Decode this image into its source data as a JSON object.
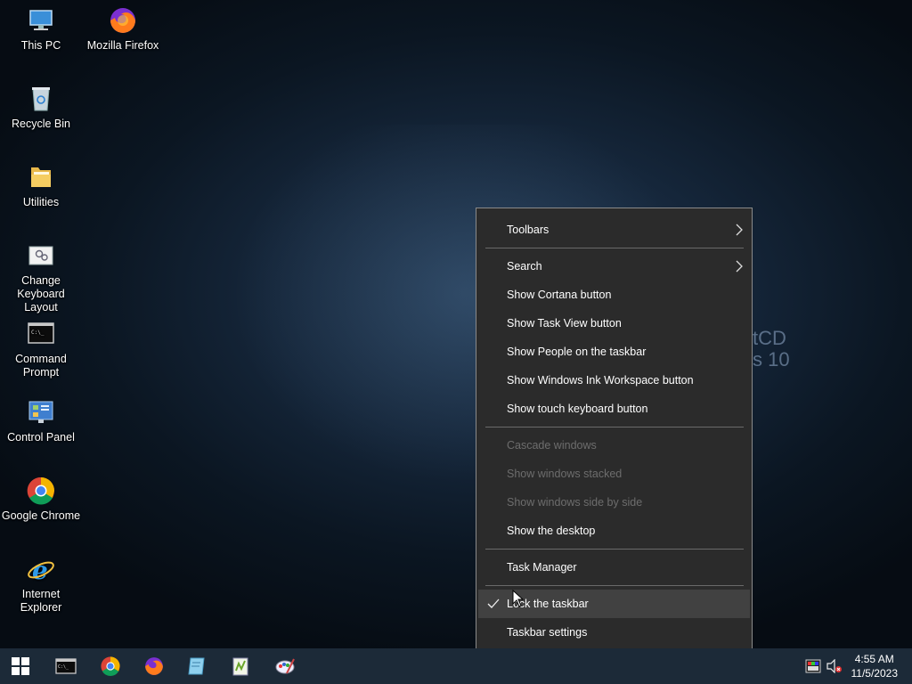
{
  "desktop": {
    "watermark_lines": [
      "tCD",
      "s 10"
    ],
    "icons": [
      {
        "label": "This PC",
        "icon": "this-pc-icon"
      },
      {
        "label": "Mozilla Firefox",
        "icon": "firefox-icon"
      },
      {
        "label": "Recycle Bin",
        "icon": "recycle-bin-icon"
      },
      {
        "label": "Utilities",
        "icon": "folder-icon"
      },
      {
        "label": "Change Keyboard Layout",
        "icon": "keyboard-layout-icon"
      },
      {
        "label": "Command Prompt",
        "icon": "command-prompt-icon"
      },
      {
        "label": "Control Panel",
        "icon": "control-panel-icon"
      },
      {
        "label": "Google Chrome",
        "icon": "chrome-icon"
      },
      {
        "label": "Internet Explorer",
        "icon": "internet-explorer-icon"
      }
    ]
  },
  "context_menu": {
    "items": [
      {
        "label": "Toolbars",
        "submenu": true
      },
      {
        "label": "Search",
        "submenu": true
      },
      {
        "label": "Show Cortana button"
      },
      {
        "label": "Show Task View button"
      },
      {
        "label": "Show People on the taskbar"
      },
      {
        "label": "Show Windows Ink Workspace button"
      },
      {
        "label": "Show touch keyboard button"
      },
      {
        "label": "Cascade windows",
        "disabled": true
      },
      {
        "label": "Show windows stacked",
        "disabled": true
      },
      {
        "label": "Show windows side by side",
        "disabled": true
      },
      {
        "label": "Show the desktop"
      },
      {
        "label": "Task Manager"
      },
      {
        "label": "Lock the taskbar",
        "checked": true,
        "hovered": true
      },
      {
        "label": "Taskbar settings"
      }
    ]
  },
  "taskbar": {
    "apps": [
      "start-icon",
      "command-prompt-icon",
      "chrome-icon",
      "firefox-icon",
      "notepad-icon",
      "notepad-plus-icon",
      "paint-icon"
    ],
    "clock": {
      "time": "4:55 AM",
      "date": "11/5/2023"
    },
    "tray": [
      "color-picker-icon",
      "volume-muted-icon"
    ]
  },
  "colors": {
    "menu_bg": "#2b2b2b",
    "menu_hover": "#414141",
    "taskbar_bg": "#1c2a38",
    "disabled_text": "#6d6d6d"
  }
}
